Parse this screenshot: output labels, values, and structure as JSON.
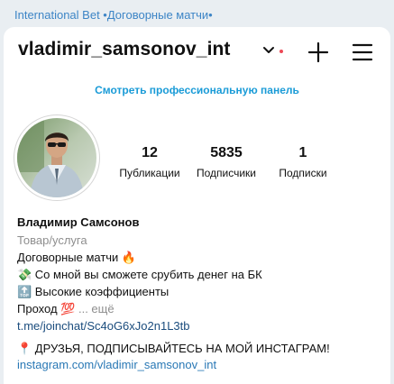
{
  "window": {
    "title": "International Bet •Договорные матчи•"
  },
  "profile": {
    "username": "vladimir_samsonov_int",
    "notification_color": "#ed4956",
    "dashboard_link": "Смотреть профессиональную панель",
    "avatar_icon": "person-photo-icon"
  },
  "stats": {
    "posts": {
      "count": "12",
      "label": "Публикации"
    },
    "followers": {
      "count": "5835",
      "label": "Подписчики"
    },
    "following": {
      "count": "1",
      "label": "Подписки"
    }
  },
  "bio": {
    "name": "Владимир Самсонов",
    "category": "Товар/услуга",
    "line1": "Договорные матчи 🔥",
    "line2": "💸 Со мной вы сможете срубить денег на БК",
    "line3": "🔝 Высокие коэффициенты",
    "line4_text": "Проход 💯",
    "line4_more": "... ещё",
    "link": "t.me/joinchat/Sc4oG6xJo2n1L3tb",
    "line6": "📍 ДРУЗЬЯ, ПОДПИСЫВАЙТЕСЬ НА МОЙ ИНСТАГРАМ!",
    "website": "instagram.com/vladimir_samsonov_int"
  },
  "colors": {
    "accent": "#1a9bd7",
    "header_text": "#3d85c6",
    "link": "#1a4c7d",
    "muted": "#8e8e8e"
  }
}
